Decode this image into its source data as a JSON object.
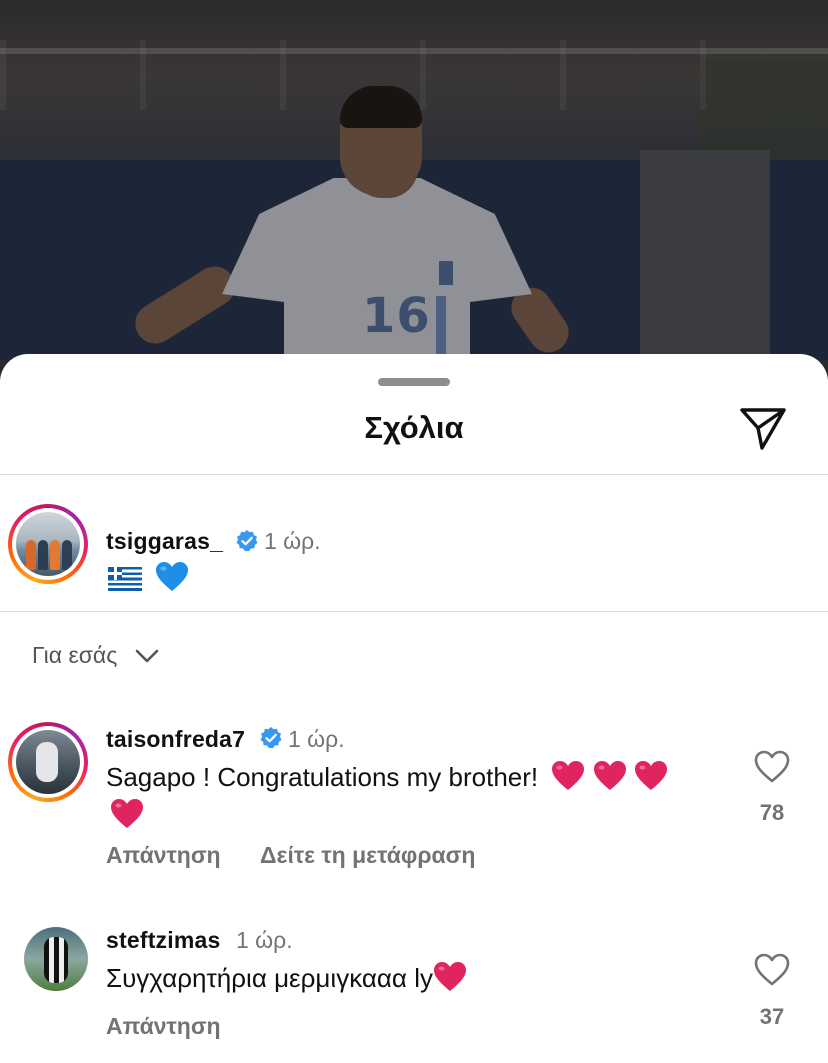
{
  "sheet": {
    "title": "Σχόλια",
    "share_icon": "paper-plane-icon"
  },
  "caption": {
    "username": "tsiggaras_",
    "verified": true,
    "time": "1 ώρ.",
    "text_emoji": [
      "greek-flag",
      "blue-heart"
    ]
  },
  "filter": {
    "label": "Για εσάς",
    "icon": "chevron-down-icon"
  },
  "comments": [
    {
      "username": "taisonfreda7",
      "verified": true,
      "time": "1 ώρ.",
      "text": "Sagapo ! Congratulations my brother!",
      "trailing_emoji": [
        "red-heart",
        "red-heart",
        "red-heart",
        "red-heart"
      ],
      "likes": "78",
      "reply_label": "Απάντηση",
      "translate_label": "Δείτε τη μετάφραση"
    },
    {
      "username": "steftzimas",
      "verified": false,
      "time": "1 ώρ.",
      "text": "Συγχαρητήρια μερμιγκααα ly",
      "trailing_emoji": [
        "red-heart"
      ],
      "likes": "37",
      "reply_label": "Απάντηση"
    }
  ],
  "colors": {
    "accent_verified": "#3897f0",
    "secondary_text": "#737373",
    "heart_red": "#e0245e",
    "blue_heart": "#1d8fe8"
  }
}
